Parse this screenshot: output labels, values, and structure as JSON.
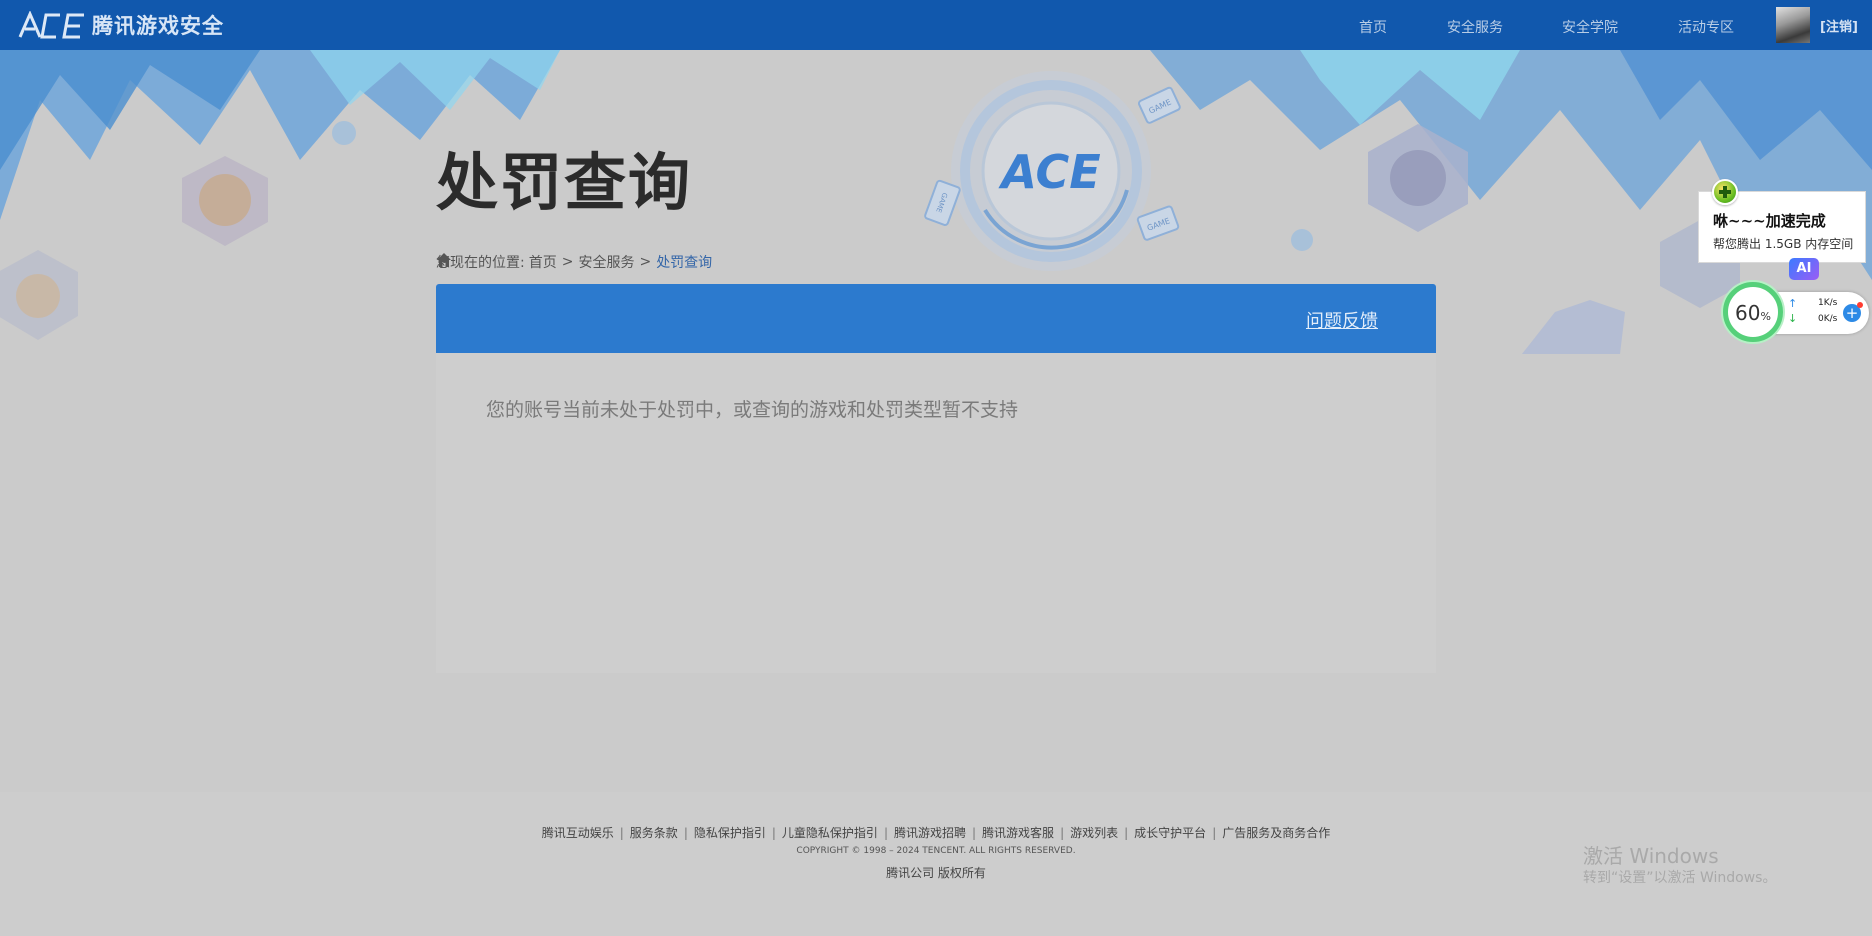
{
  "header": {
    "logo_mark": "ACE",
    "logo_text": "腾讯游戏安全",
    "nav": [
      {
        "label": "首页"
      },
      {
        "label": "安全服务"
      },
      {
        "label": "安全学院"
      },
      {
        "label": "活动专区"
      }
    ],
    "logout_label": "[注销]"
  },
  "hero": {
    "page_title": "处罚查询",
    "ace_emblem": "ACE",
    "game_tag_1": "GAME",
    "game_tag_2": "GAME",
    "game_tag_3": "GAME"
  },
  "breadcrumb": {
    "prefix": "您现在的位置:",
    "items": [
      "首页",
      "安全服务",
      "处罚查询"
    ],
    "separator": ">"
  },
  "card": {
    "feedback_label": "问题反馈",
    "message": "您的账号当前未处于处罚中，或查询的游戏和处罚类型暂不支持"
  },
  "footer": {
    "links": [
      "腾讯互动娱乐",
      "服务条款",
      "隐私保护指引",
      "儿童隐私保护指引",
      "腾讯游戏招聘",
      "腾讯游戏客服",
      "游戏列表",
      "成长守护平台",
      "广告服务及商务合作"
    ],
    "link_divider": "|",
    "copyright": "COPYRIGHT © 1998 – 2024 TENCENT. ALL RIGHTS RESERVED.",
    "company": "腾讯公司 版权所有"
  },
  "windows_watermark": {
    "line1": "激活 Windows",
    "line2": "转到“设置”以激活 Windows。"
  },
  "speed_widget": {
    "popup_title": "咻~~~加速完成",
    "popup_sub": "帮您腾出 1.5GB 内存空间",
    "ai_label": "AI",
    "usage_value": "60",
    "usage_unit": "%",
    "upload": "1K/s",
    "download": "0K/s",
    "add_label": "+"
  },
  "colors": {
    "topbar": "#1158ad",
    "card_header": "#2c7ace",
    "accent_link": "#3466a8"
  }
}
